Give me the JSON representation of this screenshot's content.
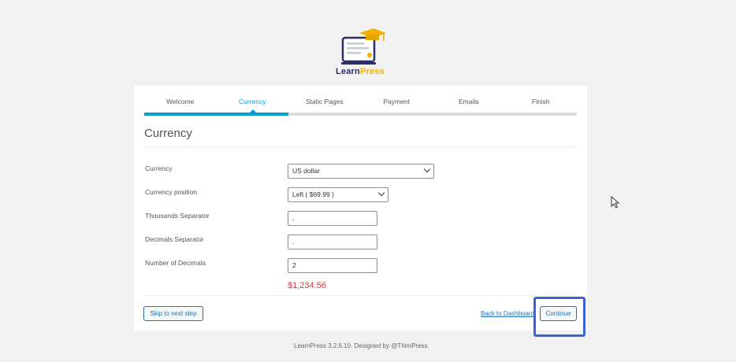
{
  "brand": {
    "name_part1": "Learn",
    "name_part2": "Press",
    "accent": "#f3b200",
    "dark": "#2b2d6e"
  },
  "steps": [
    {
      "label": "Welcome"
    },
    {
      "label": "Currency"
    },
    {
      "label": "Static Pages"
    },
    {
      "label": "Payment"
    },
    {
      "label": "Emails"
    },
    {
      "label": "Finish"
    }
  ],
  "active_step": "Currency",
  "section_title": "Currency",
  "form": {
    "currency_label": "Currency",
    "currency_value": "US dollar",
    "position_label": "Currency position",
    "position_value": "Left ( $69.99 )",
    "thousands_label": "Thousands Separator",
    "thousands_value": ",",
    "decimals_label": "Decimals Separator",
    "decimals_value": ".",
    "num_decimals_label": "Number of Decimals",
    "num_decimals_value": "2",
    "preview": "$1,234.56"
  },
  "actions": {
    "skip": "Skip to next step",
    "back": "Back to Dashboard",
    "continue": "Continue"
  },
  "footer": "LearnPress 3.2.6.10. Designed by @ThimPress.",
  "colors": {
    "primary": "#00a0d2",
    "button": "#2271b1",
    "preview": "#dc3232",
    "highlight": "#3b63d6"
  }
}
